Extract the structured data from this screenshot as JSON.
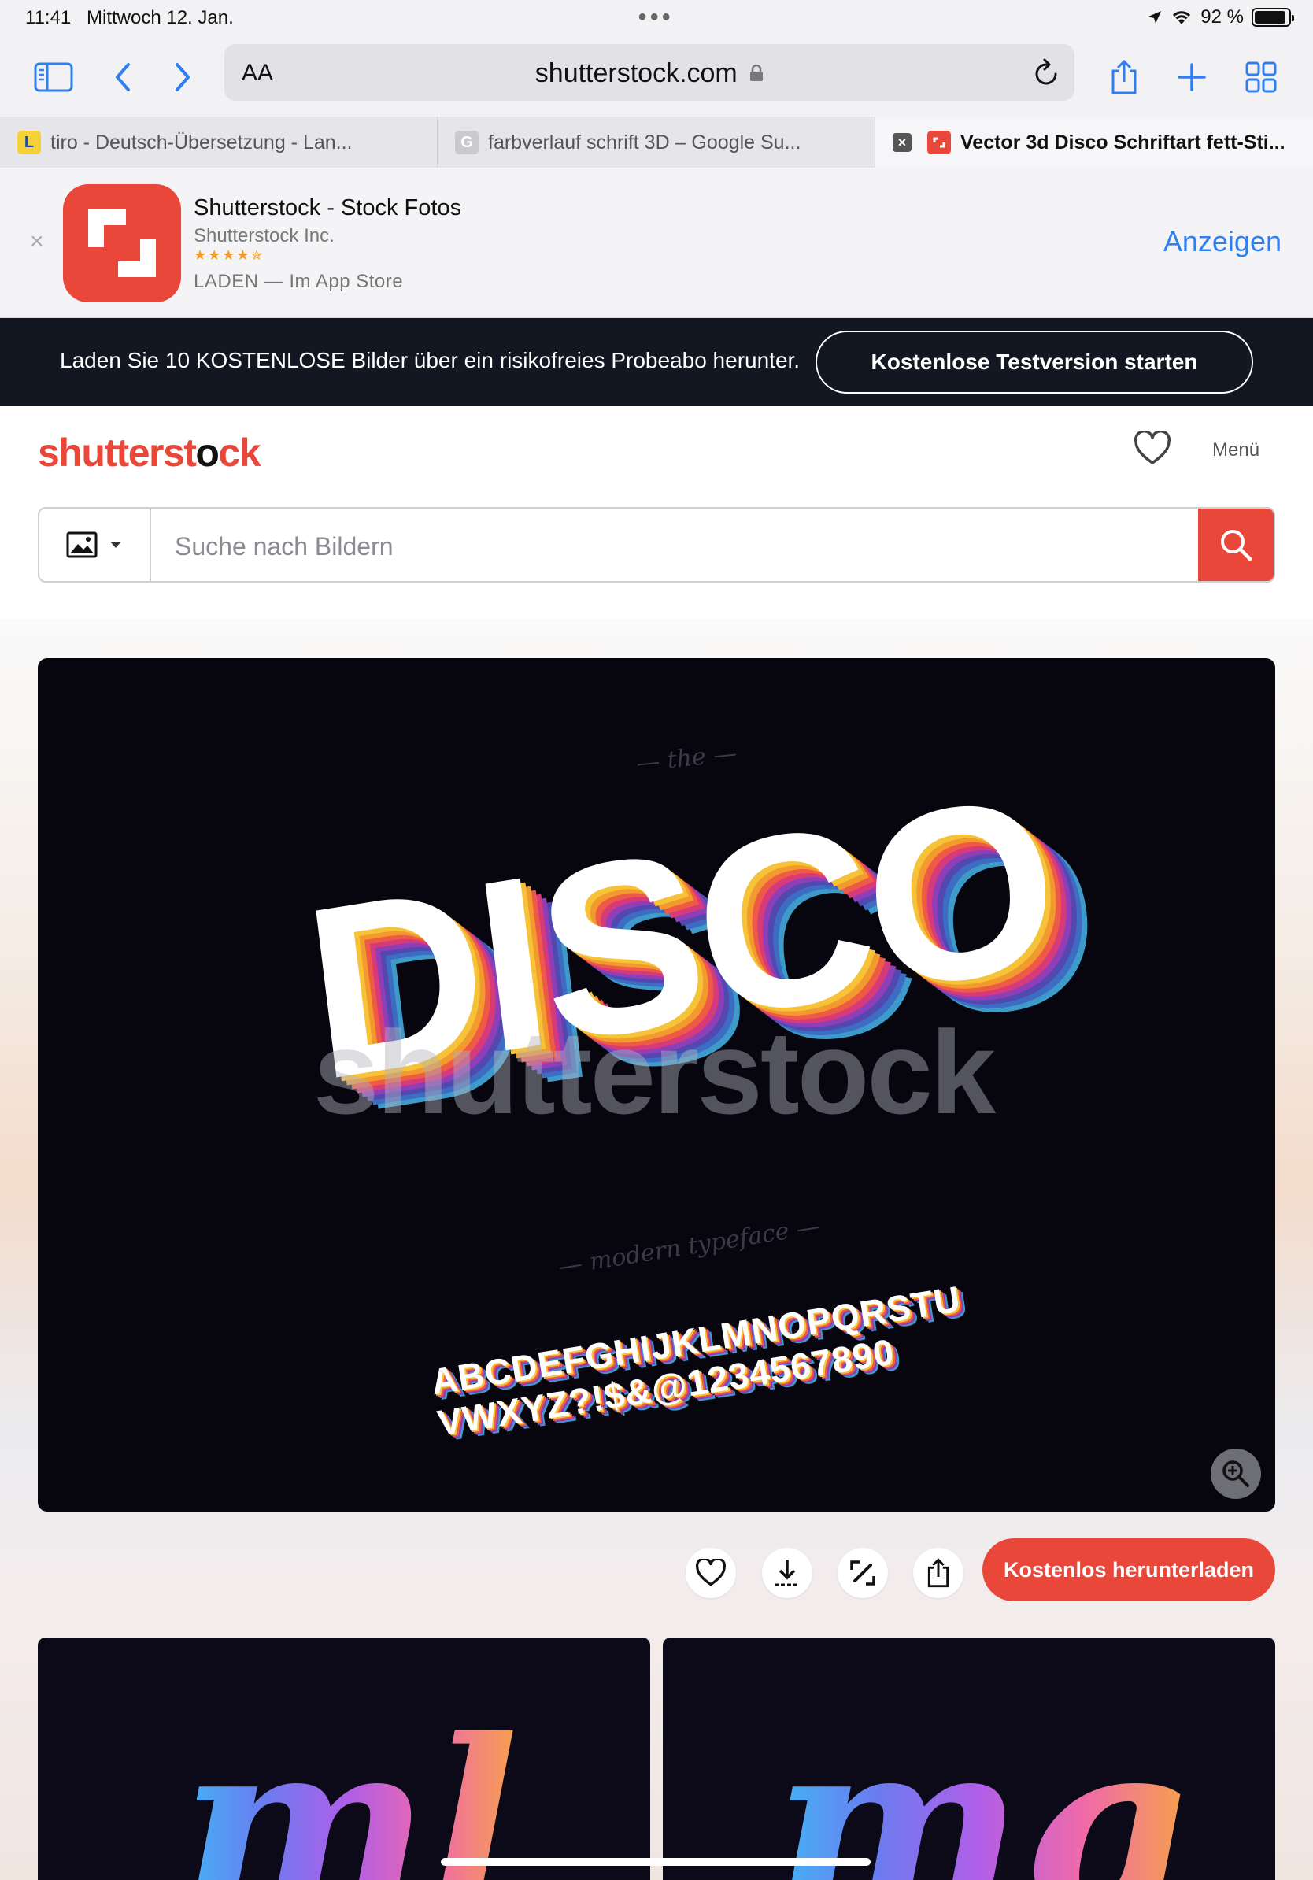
{
  "status": {
    "time": "11:41",
    "date": "Mittwoch 12. Jan.",
    "battery": "92 %",
    "battery_level": 0.92
  },
  "browser": {
    "reader_label": "AA",
    "host": "shutterstock.com",
    "tabs": [
      {
        "favicon": "L",
        "title": "tiro - Deutsch-Übersetzung - Lan..."
      },
      {
        "favicon": "G",
        "title": "farbverlauf schrift 3D – Google Su..."
      },
      {
        "close": "×",
        "title": "Vector 3d Disco Schriftart fett-Sti..."
      }
    ]
  },
  "app_banner": {
    "title": "Shutterstock - Stock Fotos",
    "developer": "Shutterstock Inc.",
    "stars": "★★★★✯",
    "store_line": "LADEN — Im App Store",
    "view_label": "Anzeigen",
    "close_label": "×"
  },
  "promo": {
    "message": "Laden Sie 10 KOSTENLOSE Bilder über ein risikofreies Probeabo herunter.",
    "cta": "Kostenlose Testversion starten"
  },
  "site": {
    "logo_a": "shutterst",
    "logo_b": "o",
    "logo_c": "ck",
    "menu_label": "Menü",
    "search_placeholder": "Suche nach Bildern"
  },
  "preview": {
    "the": "— the —",
    "title": "DISCO",
    "watermark": "shutterstock",
    "subtitle": "— modern typeface —",
    "alphabet_line1": "ABCDEFGHIJKLMNOPQRSTU",
    "alphabet_line2": "VWXYZ?!$&@1234567890"
  },
  "actions": {
    "download_label": "Kostenlos herunterladen"
  },
  "related": {
    "thumb1_word": "ml",
    "thumb2_word": "mg"
  },
  "colors": {
    "brand": "#e8473a",
    "link": "#2f7ff0",
    "promo_bg": "#131722"
  }
}
